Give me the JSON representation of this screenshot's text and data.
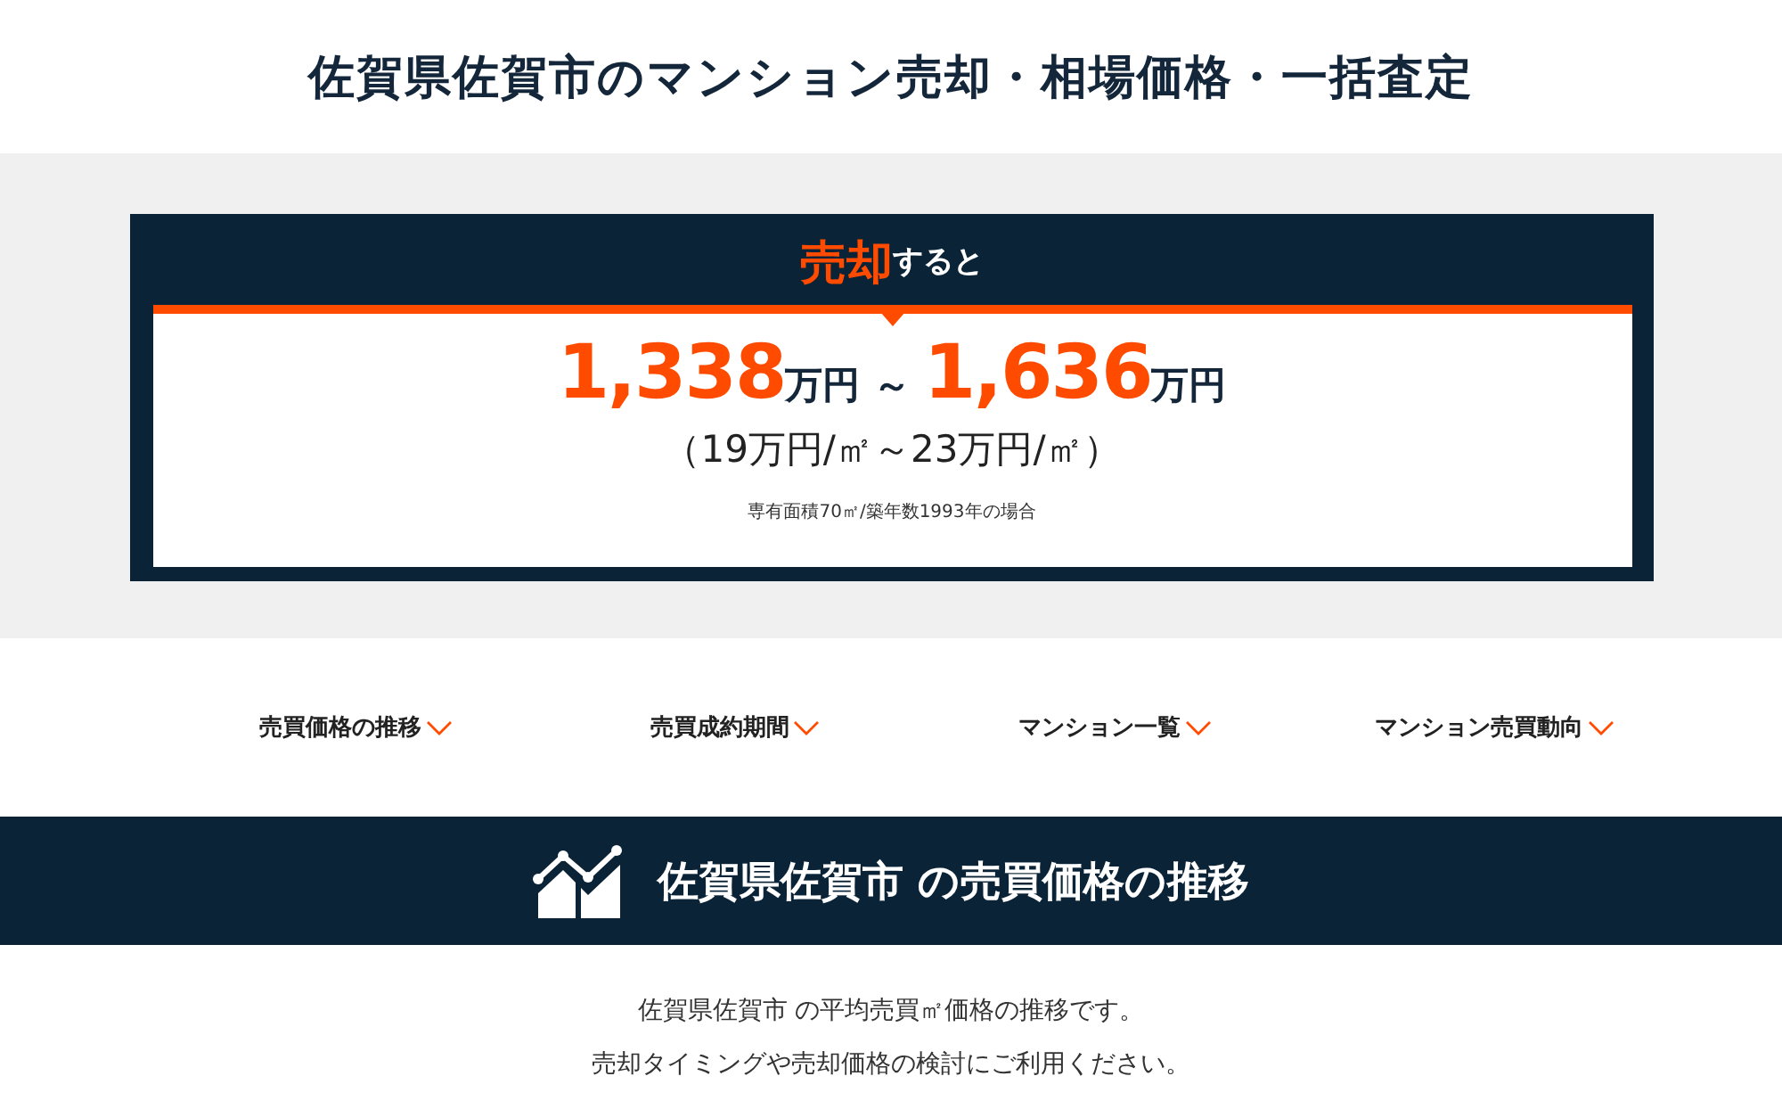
{
  "page_title": "佐賀県佐賀市のマンション売却・相場価格・一括査定",
  "estimate": {
    "heading": "**売却**すると",
    "price_range": "**1,338**万円 ～ **1,636**万円",
    "per_sqm": "（19万円/㎡～23万円/㎡）",
    "condition": "専有面積70㎡/築年数1993年の場合"
  },
  "nav": [
    {
      "label": "売買価格の推移"
    },
    {
      "label": "売買成約期間"
    },
    {
      "label": "マンション一覧"
    },
    {
      "label": "マンション売買動向"
    }
  ],
  "section": {
    "title": "佐賀県佐賀市 の売買価格の推移",
    "description": [
      "佐賀県佐賀市 の平均売買㎡価格の推移です。",
      "売却タイミングや売却価格の検討にご利用ください。"
    ]
  }
}
